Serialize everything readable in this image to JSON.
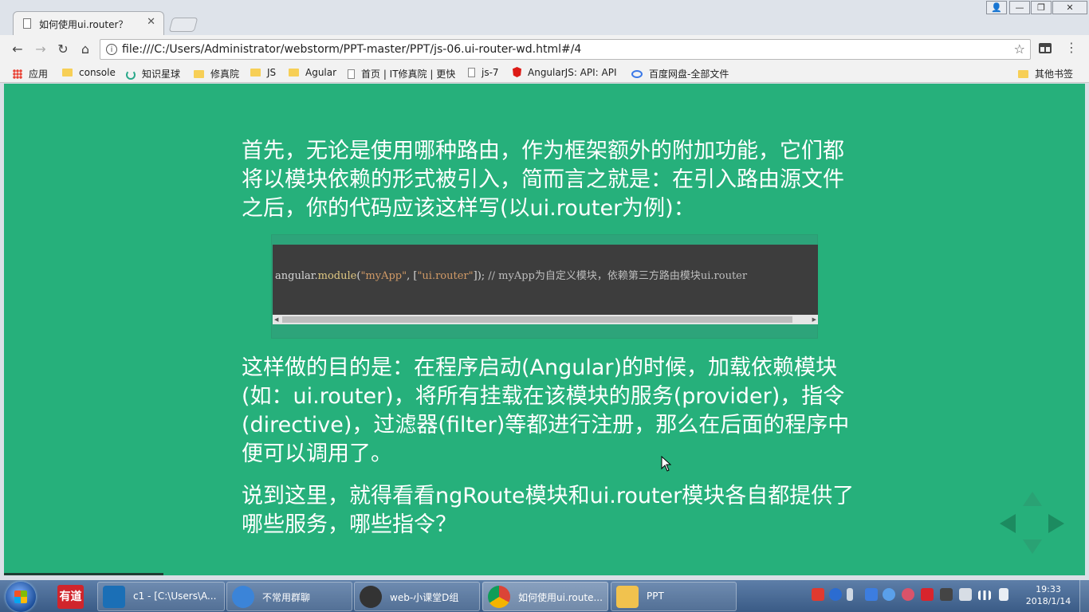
{
  "browser": {
    "tab_title": "如何使用ui.router？",
    "tab_close": "✕",
    "window_buttons": {
      "user": "👤",
      "minimize": "—",
      "restore": "❐",
      "close": "✕"
    },
    "url": "file:///C:/Users/Administrator/webstorm/PPT-master/PPT/js-06.ui-router-wd.html#/4",
    "nav": {
      "back": "←",
      "forward": "→",
      "reload": "↻",
      "home": "⌂"
    },
    "star": "☆",
    "menu": "⋮"
  },
  "bookmarks": {
    "items": [
      {
        "label": "应用",
        "icon": "apps-icon"
      },
      {
        "label": "console",
        "icon": "folder-icon"
      },
      {
        "label": "知识星球",
        "icon": "ring-icon"
      },
      {
        "label": "修真院",
        "icon": "folder-icon"
      },
      {
        "label": "JS",
        "icon": "folder-icon"
      },
      {
        "label": "Agular",
        "icon": "folder-icon"
      },
      {
        "label": "首页 | IT修真院 | 更快",
        "icon": "page-icon"
      },
      {
        "label": "js-7",
        "icon": "page-icon"
      },
      {
        "label": "AngularJS: API: API",
        "icon": "angular-icon"
      },
      {
        "label": "百度网盘-全部文件",
        "icon": "baidu-icon"
      }
    ],
    "other": "其他书签"
  },
  "slide": {
    "para1": "首先，无论是使用哪种路由，作为框架额外的附加功能，它们都将以模块依赖的形式被引入，简而言之就是：在引入路由源文件之后，你的代码应该这样写(以ui.router为例)：",
    "code": {
      "p1": "angular.",
      "fn": "module",
      "p2": "(",
      "s1": "\"myApp\"",
      "p3": ", [",
      "s2": "\"ui.router\"",
      "p4": "]); ",
      "comment": "// myApp为自定义模块，依赖第三方路由模块ui.router"
    },
    "para2": "这样做的目的是：在程序启动(Angular)的时候，加载依赖模块(如：ui.router)，将所有挂载在该模块的服务(provider)，指令(directive)，过滤器(filter)等都进行注册，那么在后面的程序中便可以调用了。",
    "para3": "说到这里，就得看看ngRoute模块和ui.router模块各自都提供了哪些服务，哪些指令？",
    "scroll_left": "◀",
    "scroll_right": "▶"
  },
  "taskbar": {
    "quick_launch": "有道",
    "items": [
      {
        "label": "c1 - [C:\\Users\\A...",
        "color": "#1b6fb6"
      },
      {
        "label": "不常用群聊",
        "color": "#3b84d8"
      },
      {
        "label": "web-小课堂D组",
        "color": "#333333"
      },
      {
        "label": "如何使用ui.route...",
        "color": "#e8eaed"
      },
      {
        "label": "PPT",
        "color": "#f1c24e"
      }
    ],
    "time": "19:33",
    "date": "2018/1/14"
  }
}
